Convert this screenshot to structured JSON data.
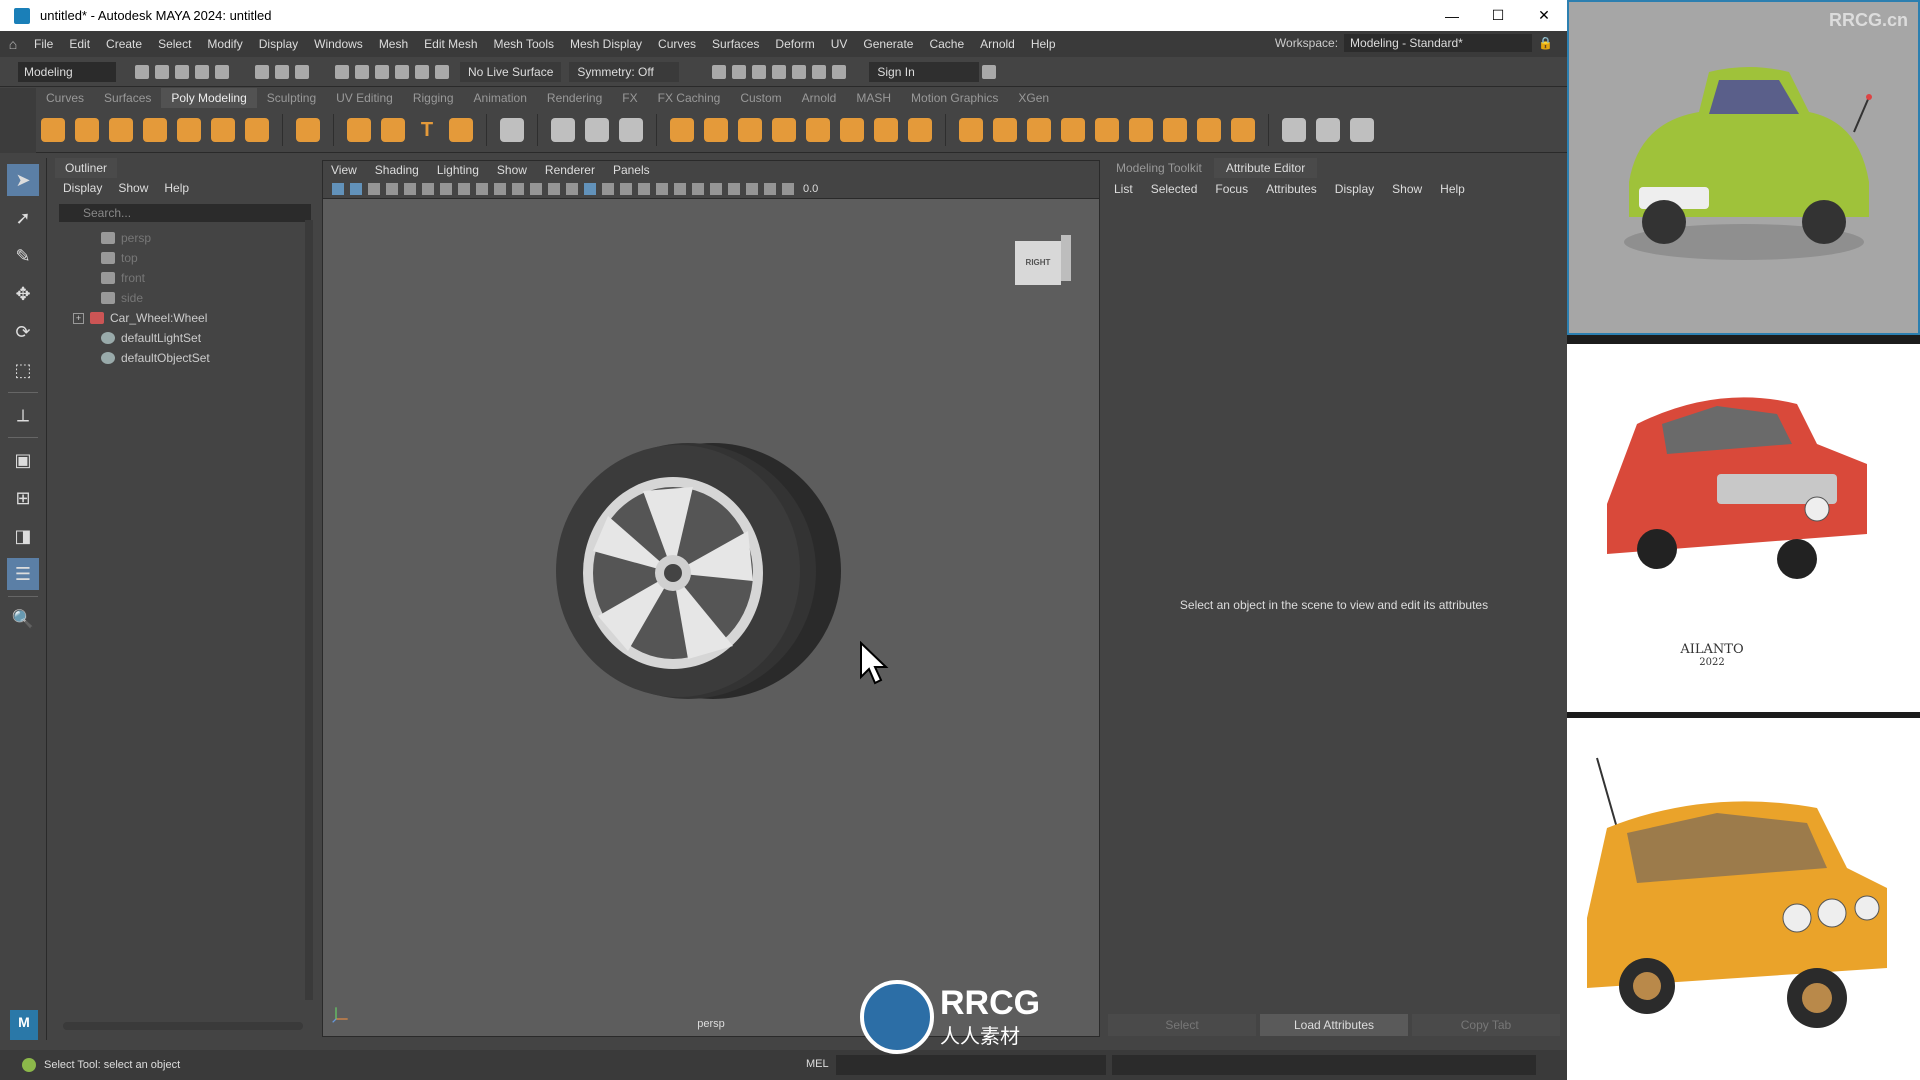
{
  "window": {
    "title": "untitled* - Autodesk MAYA 2024: untitled",
    "controls": [
      "—",
      "☐",
      "✕"
    ]
  },
  "menubar": {
    "items": [
      "File",
      "Edit",
      "Create",
      "Select",
      "Modify",
      "Display",
      "Windows",
      "Mesh",
      "Edit Mesh",
      "Mesh Tools",
      "Mesh Display",
      "Curves",
      "Surfaces",
      "Deform",
      "UV",
      "Generate",
      "Cache",
      "Arnold",
      "Help"
    ],
    "workspace_label": "Workspace:",
    "workspace_value": "Modeling - Standard*"
  },
  "statusline": {
    "mode": "Modeling",
    "live_surface": "No Live Surface",
    "symmetry": "Symmetry: Off",
    "sign_in": "Sign In"
  },
  "shelf": {
    "tabs": [
      "Curves",
      "Surfaces",
      "Poly Modeling",
      "Sculpting",
      "UV Editing",
      "Rigging",
      "Animation",
      "Rendering",
      "FX",
      "FX Caching",
      "Custom",
      "Arnold",
      "MASH",
      "Motion Graphics",
      "XGen"
    ],
    "active_tab": "Poly Modeling"
  },
  "outliner": {
    "title": "Outliner",
    "menu": [
      "Display",
      "Show",
      "Help"
    ],
    "search_placeholder": "Search...",
    "items": [
      {
        "label": "persp",
        "type": "camera",
        "dim": true
      },
      {
        "label": "top",
        "type": "camera",
        "dim": true
      },
      {
        "label": "front",
        "type": "camera",
        "dim": true
      },
      {
        "label": "side",
        "type": "camera",
        "dim": true
      },
      {
        "label": "Car_Wheel:Wheel",
        "type": "mesh",
        "dim": false
      },
      {
        "label": "defaultLightSet",
        "type": "set",
        "dim": false
      },
      {
        "label": "defaultObjectSet",
        "type": "set",
        "dim": false
      }
    ]
  },
  "viewport": {
    "menu": [
      "View",
      "Shading",
      "Lighting",
      "Show",
      "Renderer",
      "Panels"
    ],
    "toolbar_value": "0.0",
    "camera_label": "persp",
    "viewcube_label": "RIGHT"
  },
  "attribute_editor": {
    "tabs": [
      "Modeling Toolkit",
      "Attribute Editor"
    ],
    "active_tab": "Attribute Editor",
    "menu": [
      "List",
      "Selected",
      "Focus",
      "Attributes",
      "Display",
      "Show",
      "Help"
    ],
    "hint": "Select an object in the scene to view and edit its attributes",
    "buttons": [
      "Select",
      "Load Attributes",
      "Copy Tab"
    ]
  },
  "helpline": {
    "text": "Select Tool: select an object",
    "mel_label": "MEL"
  },
  "references": {
    "watermark": "RRCG.cn",
    "signature_name": "AILANTO",
    "signature_year": "2022"
  },
  "overlay": {
    "brand": "RRCG",
    "brand_sub": "人人素材"
  },
  "colors": {
    "accent": "#5b7fa6",
    "maya_blue": "#2a78a8"
  }
}
